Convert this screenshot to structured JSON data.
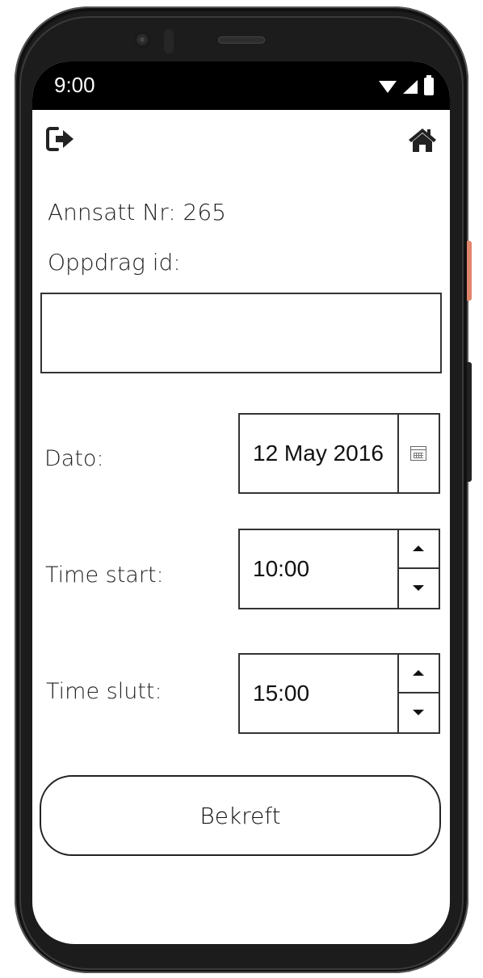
{
  "status_bar": {
    "time": "9:00",
    "icons": [
      "wifi-icon",
      "signal-icon",
      "battery-icon"
    ]
  },
  "app_bar": {
    "left_icon": "logout-icon",
    "right_icon": "home-icon"
  },
  "form": {
    "employee_label": "Annsatt Nr: 265",
    "task_id_label": "Oppdrag id:",
    "task_id_value": "",
    "date_label": "Dato:",
    "date_value": "12 May 2016",
    "date_icon": "calendar-icon",
    "start_label": "Time start:",
    "start_value": "10:00",
    "end_label": "Time slutt:",
    "end_value": "15:00",
    "confirm_label": "Bekreft"
  },
  "colors": {
    "frame": "#1c1c1c",
    "accent_button": "#e0846b",
    "text": "#222222"
  }
}
